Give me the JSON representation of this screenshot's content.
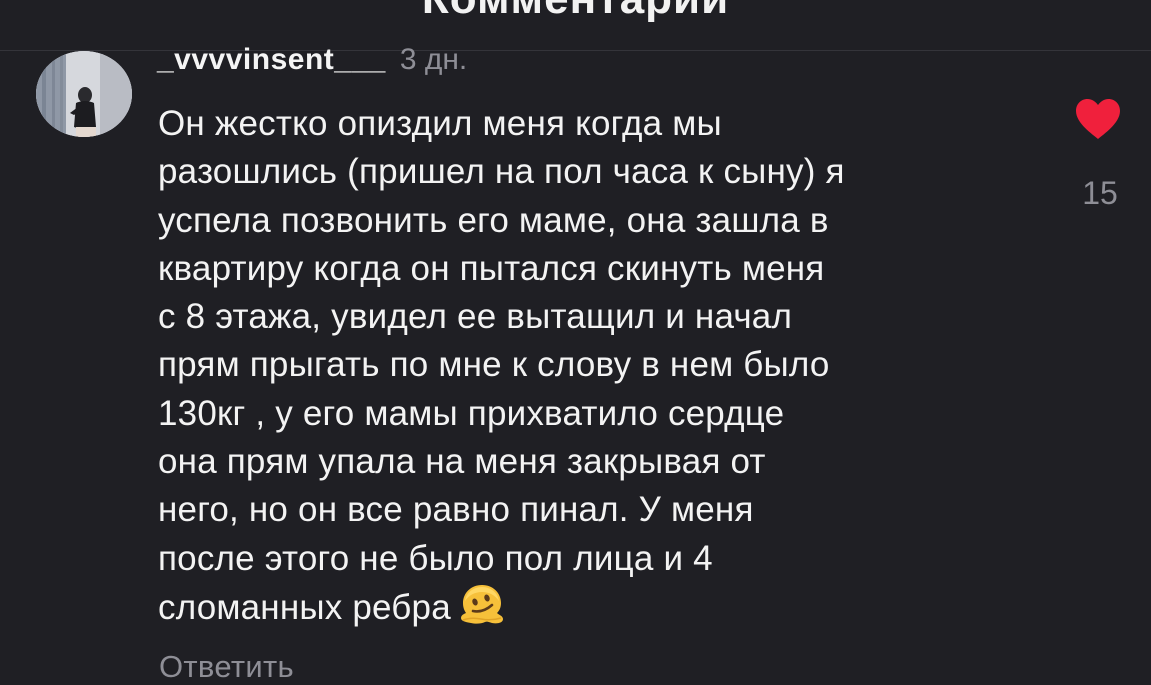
{
  "header": {
    "title": "Комментарии"
  },
  "comment": {
    "username": "_vvvvinsent___",
    "timestamp": "3 дн.",
    "text": "Он жестко опиздил меня когда мы\nразошлись (пришел на пол часа к сыну) я\nуспела позвонить его маме, она зашла в\nквартиру когда он пытался скинуть меня\nс 8 этажа, увидел ее вытащил и начал\nпрям прыгать по мне к слову в нем было\n130кг , у его мамы прихватило сердце\nона прям упала на меня закрывая от\nнего, но он все равно пинал. У меня\nпосле этого не было пол лица и 4\nсломанных ребра",
    "emoji": "melting-face-emoji",
    "reply_label": "Ответить",
    "like_count": "15",
    "liked": true,
    "heart_color": "#f0203c",
    "avatar": "avatar-photo"
  }
}
